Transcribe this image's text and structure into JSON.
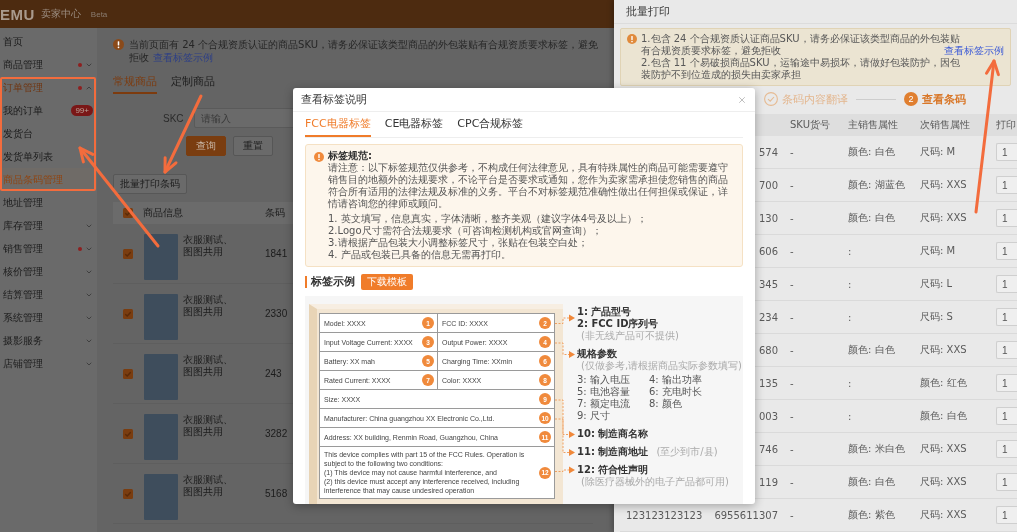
{
  "top_bar": {
    "logo": "EMU",
    "title": "卖家中心",
    "tag": "Beta"
  },
  "sidebar": {
    "items": [
      {
        "label": "首页",
        "selected": false,
        "dot": false
      },
      {
        "label": "商品管理",
        "selected": false,
        "dot": true,
        "expanded": false
      },
      {
        "label": "订单管理",
        "selected": false,
        "dot": true,
        "expanded": true,
        "children": [
          {
            "label": "我的订单",
            "selected": false,
            "badge": "99+"
          },
          {
            "label": "发货台",
            "selected": false
          },
          {
            "label": "发货单列表",
            "selected": false
          },
          {
            "label": "商品条码管理",
            "selected": true
          }
        ]
      },
      {
        "label": "地址管理",
        "selected": false,
        "dot": false
      },
      {
        "label": "库存管理",
        "selected": false,
        "dot": false,
        "expanded": false
      },
      {
        "label": "销售管理",
        "selected": false,
        "dot": true,
        "expanded": false
      },
      {
        "label": "核价管理",
        "selected": false,
        "dot": false,
        "expanded": false
      },
      {
        "label": "结算管理",
        "selected": false,
        "dot": false,
        "expanded": false
      },
      {
        "label": "系统管理",
        "selected": false,
        "dot": false,
        "expanded": false
      },
      {
        "label": "摄影服务",
        "selected": false,
        "dot": false,
        "expanded": false
      },
      {
        "label": "店铺管理",
        "selected": false,
        "dot": false,
        "expanded": false
      }
    ]
  },
  "notice": {
    "text": "当前页面有 24 个合规资质认证的商品SKU，请务必保证该类型商品的外包装贴有合规资质要求标签，避免拒收",
    "link": "查看标签示例"
  },
  "tabs": [
    {
      "label": "常规商品",
      "selected": true
    },
    {
      "label": "定制商品",
      "selected": false
    }
  ],
  "search": {
    "label": "SKC",
    "placeholder": "请输入",
    "buttons": [
      {
        "label": "查询",
        "kind": "primary"
      },
      {
        "label": "重置",
        "kind": "default"
      }
    ]
  },
  "batch_print_button": "批量打印条码",
  "product_table": {
    "select_all_checked": true,
    "columns": [
      "商品信息",
      "条码"
    ],
    "rows": [
      {
        "checked": true,
        "name": "衣服测试、图图共用",
        "barcode": "1841"
      },
      {
        "checked": true,
        "name": "衣服测试、图图共用",
        "barcode": "2330"
      },
      {
        "checked": true,
        "name": "衣服测试、图图共用",
        "barcode": "243"
      },
      {
        "checked": true,
        "name": "衣服测试、图图共用",
        "barcode": "3282"
      },
      {
        "checked": true,
        "name": "衣服测试、图图共用",
        "barcode": "5168"
      }
    ]
  },
  "drawer": {
    "title": "批量打印",
    "alert": [
      {
        "text": "1.包含 24 个合规资质认证商品SKU，请务必保证该类型商品的外包装贴有合规资质要求标签，避免拒收",
        "link": "查看标签示例"
      },
      {
        "text": "2.包含 11 个易破损商品SKU，运输途中易损坏，请做好包装防护，因包装防护不到位造成的损失由卖家承担"
      }
    ],
    "steps": [
      {
        "label": "条码内容翻译",
        "done": true,
        "current": false
      },
      {
        "number": "2",
        "label": "查看条码",
        "done": false,
        "current": true
      }
    ],
    "table": {
      "columns": [
        "SKU货号",
        "主销售属性",
        "次销售属性",
        "打印"
      ],
      "rows": [
        {
          "column_2": "574",
          "sku_code": "-",
          "main_attribute": "颜色: 白色",
          "secondary_attribute": "尺码: M",
          "print_quantity": "1"
        },
        {
          "column_2": "700",
          "sku_code": "-",
          "main_attribute": "颜色: 湖蓝色",
          "secondary_attribute": "尺码: XXS",
          "print_quantity": "1"
        },
        {
          "column_2": "130",
          "sku_code": "-",
          "main_attribute": "颜色: 白色",
          "secondary_attribute": "尺码: XXS",
          "print_quantity": "1"
        },
        {
          "column_2": "606",
          "sku_code": "-",
          "main_attribute": ":",
          "secondary_attribute": "尺码: M",
          "print_quantity": "1"
        },
        {
          "column_2": "345",
          "sku_code": "-",
          "main_attribute": ":",
          "secondary_attribute": "尺码: L",
          "print_quantity": "1"
        },
        {
          "column_2": "234",
          "sku_code": "-",
          "main_attribute": ":",
          "secondary_attribute": "尺码: S",
          "print_quantity": "1"
        },
        {
          "column_2": "680",
          "sku_code": "-",
          "main_attribute": "颜色: 白色",
          "secondary_attribute": "尺码: XXS",
          "print_quantity": "1"
        },
        {
          "column_2": "135",
          "sku_code": "-",
          "main_attribute": ":",
          "secondary_attribute": "颜色: 红色",
          "print_quantity": "1"
        },
        {
          "column_2": "003",
          "sku_code": "-",
          "main_attribute": ":",
          "secondary_attribute": "颜色: 白色",
          "print_quantity": "1"
        },
        {
          "column_2": "746",
          "sku_code": "-",
          "main_attribute": "颜色: 米白色",
          "secondary_attribute": "尺码: XXS",
          "print_quantity": "1"
        },
        {
          "column_2": "119",
          "sku_code": "-",
          "main_attribute": "颜色: 白色",
          "secondary_attribute": "尺码: XXS",
          "print_quantity": "1"
        },
        {
          "column_1": "123123123123",
          "column_2": "6955611307",
          "sku_code": "-",
          "main_attribute": "颜色: 紫色",
          "secondary_attribute": "尺码: XXS",
          "print_quantity": "1"
        }
      ]
    }
  },
  "modal": {
    "title": "查看标签说明",
    "tabs": [
      {
        "label": "FCC电器标签",
        "selected": true
      },
      {
        "label": "CE电器标签",
        "selected": false
      },
      {
        "label": "CPC合规标签",
        "selected": false
      }
    ],
    "notice": {
      "title": "标签规范:",
      "paragraph": "请注意：以下标签规范仅供参考，不构成任何法律意见，具有特殊属性的商品可能需要遵守销售目的地额外的法规要求，不论平台是否要求或通知，您作为卖家需承担使您销售的商品符合所有适用的法律法规及标准的义务。平台不对标签规范准确性做出任何担保或保证，详情请咨询您的律师或顾问。",
      "rules": [
        "1. 英文填写，信息真实，字体清晰，整齐美观（建议字体4号及以上）；",
        "2.Logo尺寸需符合法规要求（可咨询检测机构或官网查询）；",
        "3.请根据产品包装大小调整标签尺寸，张贴在包装空白处；",
        "4. 产品或包装已具备的信息无需再打印。"
      ]
    },
    "example": {
      "title": "标签示例",
      "download_button": "下载模板",
      "label": {
        "rows": [
          [
            {
              "text": "Model: XXXX",
              "number": "1"
            },
            {
              "text": "FCC ID: XXXX",
              "number": "2"
            }
          ],
          [
            {
              "text": "Input Voltage Current: XXXX",
              "number": "3"
            },
            {
              "text": "Output Power: XXXX",
              "number": "4"
            }
          ],
          [
            {
              "text": "Battery: XX mah",
              "number": "5"
            },
            {
              "text": "Charging Time: XXmin",
              "number": "6"
            }
          ],
          [
            {
              "text": "Rated Current: XXXX",
              "number": "7"
            },
            {
              "text": "Color: XXXX",
              "number": "8"
            }
          ],
          [
            {
              "text": "Size: XXXX",
              "number": "9"
            }
          ],
          [
            {
              "text": "Manufacturer: China guangzhou  XX Electronic Co.,Ltd.",
              "number": "10"
            }
          ],
          [
            {
              "text": "Address: XX building, Renmin Road, Guangzhou, China",
              "number": "11"
            }
          ]
        ],
        "declaration": {
          "lines": [
            "This device complies with part 15 of the FCC Rules. Operation is subject to the following two conditions:",
            "(1)  This device may not cause harmful interference, and",
            "(2)  this device must accept any interference received, including interference that may cause undesired operation"
          ],
          "number": "12"
        }
      },
      "notes": [
        {
          "kind": "item",
          "text": "1: 产品型号"
        },
        {
          "kind": "item",
          "text": "2: FCC ID序列号",
          "hint": "(非无线产品可不提供)"
        },
        {
          "kind": "group",
          "text": "规格参数",
          "hint": "(仅做参考,请根据商品实际参数填写)",
          "items": [
            "3: 输入电压",
            "4: 输出功率",
            "5: 电池容量",
            "6: 充电时长",
            "7: 额定电流",
            "8: 颜色",
            "9: 尺寸"
          ]
        },
        {
          "kind": "item",
          "text": "10: 制造商名称"
        },
        {
          "kind": "item",
          "text": "11: 制造商地址",
          "hint": "(至少到市/县)"
        },
        {
          "kind": "item",
          "text": "12: 符合性声明",
          "hint": "(除医疗器械外的电子产品都可用)"
        }
      ]
    }
  }
}
